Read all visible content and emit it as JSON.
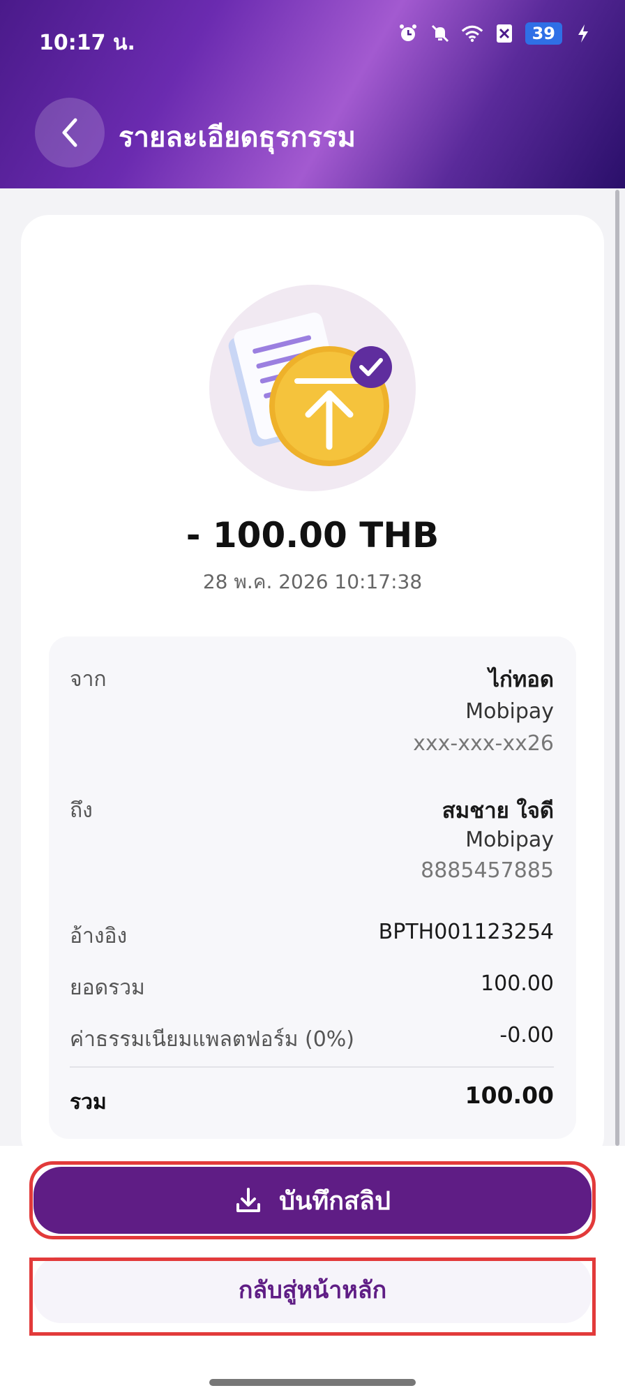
{
  "status_bar": {
    "time": "10:17 น.",
    "battery": "39"
  },
  "header": {
    "title": "รายละเอียดธุรกรรม"
  },
  "transaction": {
    "amount": "- 100.00 THB",
    "datetime": "28 พ.ค. 2026 10:17:38"
  },
  "details": {
    "from_label": "จาก",
    "from_name": "ไก่ทอด",
    "from_wallet": "Mobipay",
    "from_account": "xxx-xxx-xx26",
    "to_label": "ถึง",
    "to_name": "สมชาย ใจดี",
    "to_wallet": "Mobipay",
    "to_account": "8885457885",
    "ref_label": "อ้างอิง",
    "ref_value": "BPTH001123254",
    "subtotal_label": "ยอดรวม",
    "subtotal_value": "100.00",
    "fee_label": "ค่าธรรมเนียมแพลตฟอร์ม (0%)",
    "fee_value": "-0.00",
    "total_label": "รวม",
    "total_value": "100.00"
  },
  "actions": {
    "save_slip": "บันทึกสลิป",
    "back_home": "กลับสู่หน้าหลัก"
  },
  "colors": {
    "primary": "#5f1d85",
    "highlight": "#e23a3a"
  }
}
